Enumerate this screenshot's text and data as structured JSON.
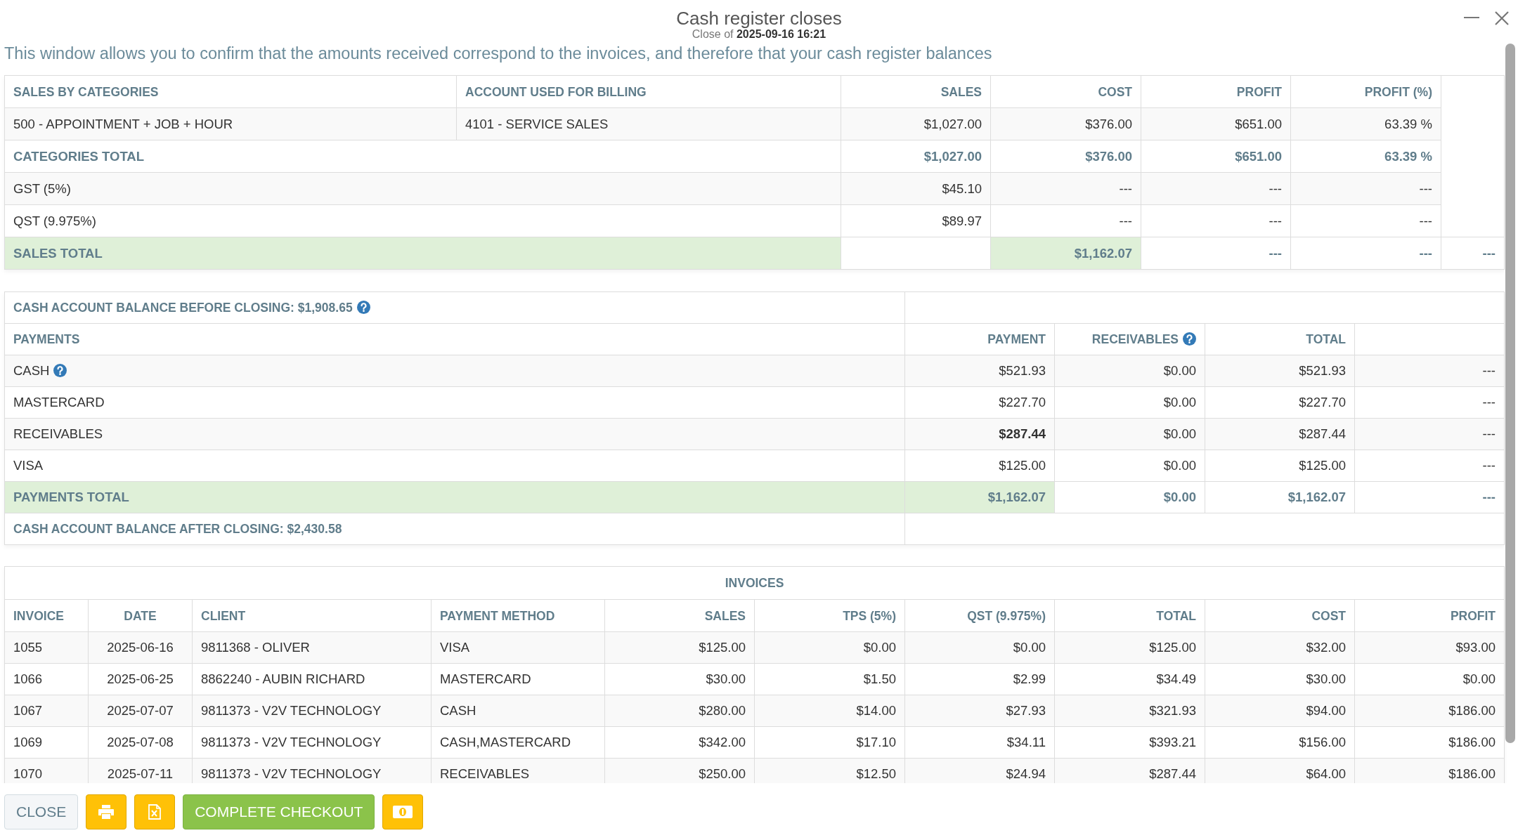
{
  "window": {
    "title": "Cash register closes",
    "subtitle": "Close of **2025-09-16 16:21**"
  },
  "description": "This window allows you to confirm that the amounts received correspond to the invoices, and therefore that your cash register balances",
  "categories": {
    "columns": [
      "SALES BY CATEGORIES",
      "ACCOUNT USED FOR BILLING",
      "SALES",
      "COST",
      "PROFIT",
      "PROFIT (%)"
    ],
    "rows": [
      {
        "kind": "category",
        "cells": [
          "500 - APPOINTMENT + JOB + HOUR",
          "4101 - SERVICE SALES",
          "$1,027.00",
          "$376.00",
          "$651.00",
          "63.39 %"
        ]
      },
      {
        "kind": "subtotal",
        "label": "CATEGORIES TOTAL",
        "values": [
          "$1,027.00",
          "$376.00",
          "$651.00",
          "63.39 %"
        ]
      },
      {
        "kind": "tax",
        "label": "GST (5%)",
        "values": [
          "$45.10",
          "---",
          "---",
          "---"
        ]
      },
      {
        "kind": "tax",
        "label": "QST (9.975%)",
        "values": [
          "$89.97",
          "---",
          "---",
          "---"
        ]
      },
      {
        "kind": "grand_total",
        "label": "SALES TOTAL",
        "highlighted": true,
        "values": [
          {
            "text": "$1,162.07",
            "highlighted": true
          },
          {
            "text": "---",
            "highlighted": false
          },
          {
            "text": "---",
            "highlighted": false
          },
          {
            "text": "---",
            "highlighted": false
          }
        ]
      }
    ]
  },
  "payments": {
    "balance_before": {
      "text": "CASH ACCOUNT BALANCE BEFORE CLOSING: $1,908.65",
      "help": true
    },
    "columns": [
      {
        "label": "PAYMENTS",
        "help": false
      },
      {
        "label": "PAYMENT",
        "help": false
      },
      {
        "label": "RECEIVABLES",
        "help": true
      },
      {
        "label": "TOTAL",
        "help": false
      }
    ],
    "rows": [
      {
        "method": "CASH",
        "help": true,
        "payment": "$521.93",
        "emphasized": false,
        "receivables": "$0.00",
        "total": "$521.93",
        "column_5": "---"
      },
      {
        "method": "MASTERCARD",
        "help": false,
        "payment": "$227.70",
        "emphasized": false,
        "receivables": "$0.00",
        "total": "$227.70",
        "column_5": "---"
      },
      {
        "method": "RECEIVABLES",
        "help": false,
        "payment": "$287.44",
        "emphasized": true,
        "receivables": "$0.00",
        "total": "$287.44",
        "column_5": "---"
      },
      {
        "method": "VISA",
        "help": false,
        "payment": "$125.00",
        "emphasized": false,
        "receivables": "$0.00",
        "total": "$125.00",
        "column_5": "---"
      }
    ],
    "total": {
      "label": "PAYMENTS TOTAL",
      "highlighted": true,
      "values": [
        {
          "text": "$1,162.07",
          "highlighted": true
        },
        {
          "text": "$0.00",
          "highlighted": false
        },
        {
          "text": "$1,162.07",
          "highlighted": false
        },
        {
          "text": "---",
          "highlighted": false
        }
      ]
    },
    "balance_after": {
      "text": "CASH ACCOUNT BALANCE AFTER CLOSING: $2,430.58",
      "help": false
    }
  },
  "invoices": {
    "title": "INVOICES",
    "columns": [
      "INVOICE",
      "DATE",
      "CLIENT",
      "PAYMENT METHOD",
      "SALES",
      "TPS (5%)",
      "QST (9.975%)",
      "TOTAL",
      "COST",
      "PROFIT"
    ],
    "rows": [
      [
        "1055",
        "2025-06-16",
        "9811368 - OLIVER",
        "VISA",
        "$125.00",
        "$0.00",
        "$0.00",
        "$125.00",
        "$32.00",
        "$93.00"
      ],
      [
        "1066",
        "2025-06-25",
        "8862240 - AUBIN RICHARD",
        "MASTERCARD",
        "$30.00",
        "$1.50",
        "$2.99",
        "$34.49",
        "$30.00",
        "$0.00"
      ],
      [
        "1067",
        "2025-07-07",
        "9811373 - V2V TECHNOLOGY",
        "CASH",
        "$280.00",
        "$14.00",
        "$27.93",
        "$321.93",
        "$94.00",
        "$186.00"
      ],
      [
        "1069",
        "2025-07-08",
        "9811373 - V2V TECHNOLOGY",
        "CASH,MASTERCARD",
        "$342.00",
        "$17.10",
        "$34.11",
        "$393.21",
        "$156.00",
        "$186.00"
      ],
      [
        "1070",
        "2025-07-11",
        "9811373 - V2V TECHNOLOGY",
        "RECEIVABLES",
        "$250.00",
        "$12.50",
        "$24.94",
        "$287.44",
        "$64.00",
        "$186.00"
      ]
    ]
  },
  "footer": {
    "close": "CLOSE",
    "checkout": "COMPLETE CHECKOUT"
  }
}
